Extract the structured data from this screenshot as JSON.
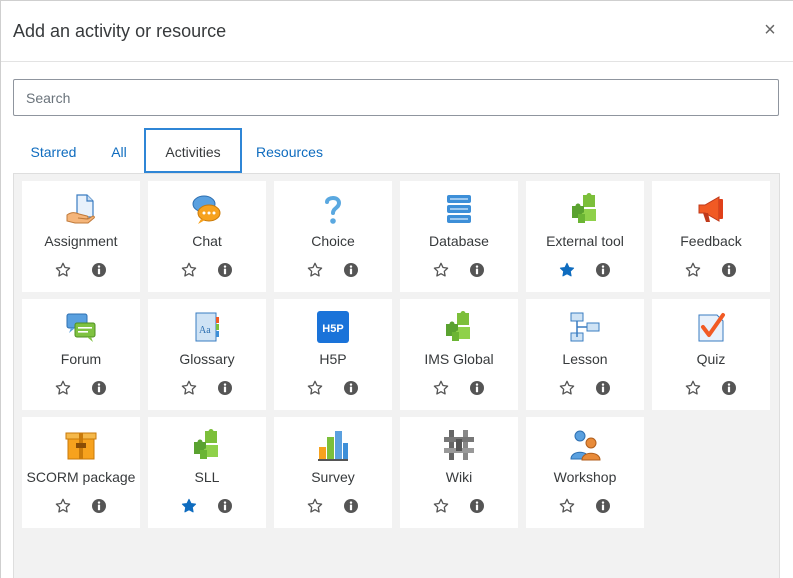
{
  "header": {
    "title": "Add an activity or resource",
    "close_label": "×"
  },
  "search": {
    "placeholder": "Search"
  },
  "tabs": [
    {
      "label": "Starred",
      "active": false
    },
    {
      "label": "All",
      "active": false
    },
    {
      "label": "Activities",
      "active": true
    },
    {
      "label": "Resources",
      "active": false
    }
  ],
  "colors": {
    "link": "#0f6cbf",
    "active_tab_border": "#2f86d6",
    "star_filled": "#0f6cbf",
    "icon_gray": "#555555"
  },
  "activities": [
    {
      "name": "Assignment",
      "icon": "assignment-icon",
      "starred": false
    },
    {
      "name": "Chat",
      "icon": "chat-icon",
      "starred": false
    },
    {
      "name": "Choice",
      "icon": "choice-icon",
      "starred": false
    },
    {
      "name": "Database",
      "icon": "database-icon",
      "starred": false
    },
    {
      "name": "External tool",
      "icon": "puzzle-icon",
      "starred": true
    },
    {
      "name": "Feedback",
      "icon": "megaphone-icon",
      "starred": false
    },
    {
      "name": "Forum",
      "icon": "forum-icon",
      "starred": false
    },
    {
      "name": "Glossary",
      "icon": "glossary-icon",
      "starred": false
    },
    {
      "name": "H5P",
      "icon": "h5p-icon",
      "icon_text": "H5P",
      "starred": false
    },
    {
      "name": "IMS Global",
      "icon": "puzzle-icon",
      "starred": false
    },
    {
      "name": "Lesson",
      "icon": "lesson-icon",
      "starred": false
    },
    {
      "name": "Quiz",
      "icon": "quiz-icon",
      "starred": false
    },
    {
      "name": "SCORM package",
      "icon": "scorm-icon",
      "starred": false
    },
    {
      "name": "SLL",
      "icon": "puzzle-icon",
      "starred": true
    },
    {
      "name": "Survey",
      "icon": "survey-icon",
      "starred": false
    },
    {
      "name": "Wiki",
      "icon": "wiki-icon",
      "starred": false
    },
    {
      "name": "Workshop",
      "icon": "workshop-icon",
      "starred": false
    }
  ]
}
